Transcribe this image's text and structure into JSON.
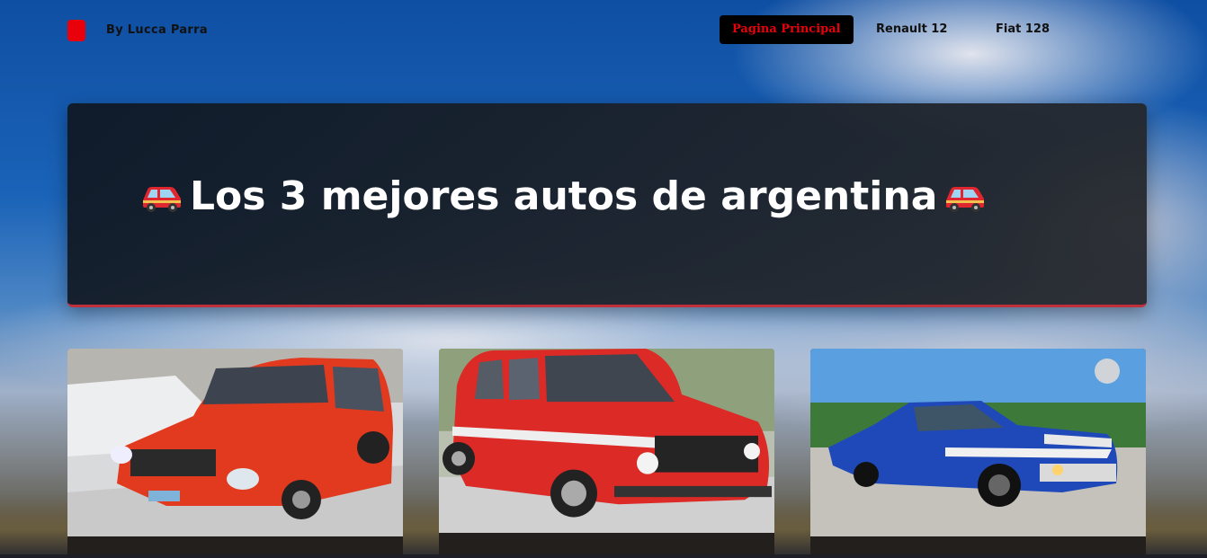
{
  "brand": {
    "logo_icon": "red-square-logo-icon",
    "text": "By Lucca Parra"
  },
  "nav": {
    "items": [
      {
        "label": "Pagina Principal",
        "active": true
      },
      {
        "label": "Renault 12",
        "active": false
      },
      {
        "label": "Fiat 128",
        "active": false
      }
    ]
  },
  "hero": {
    "title": "Los 3 mejores autos de argentina",
    "left_icon": "red-car-icon",
    "right_icon": "red-car-icon",
    "accent_color": "#c0303a"
  },
  "cards": [
    {
      "image": "red-renault-12-photo"
    },
    {
      "image": "red-fiat-128-photo"
    },
    {
      "image": "blue-ford-falcon-photo"
    }
  ],
  "colors": {
    "brand_red": "#e8000b",
    "active_nav_bg": "#000000"
  }
}
